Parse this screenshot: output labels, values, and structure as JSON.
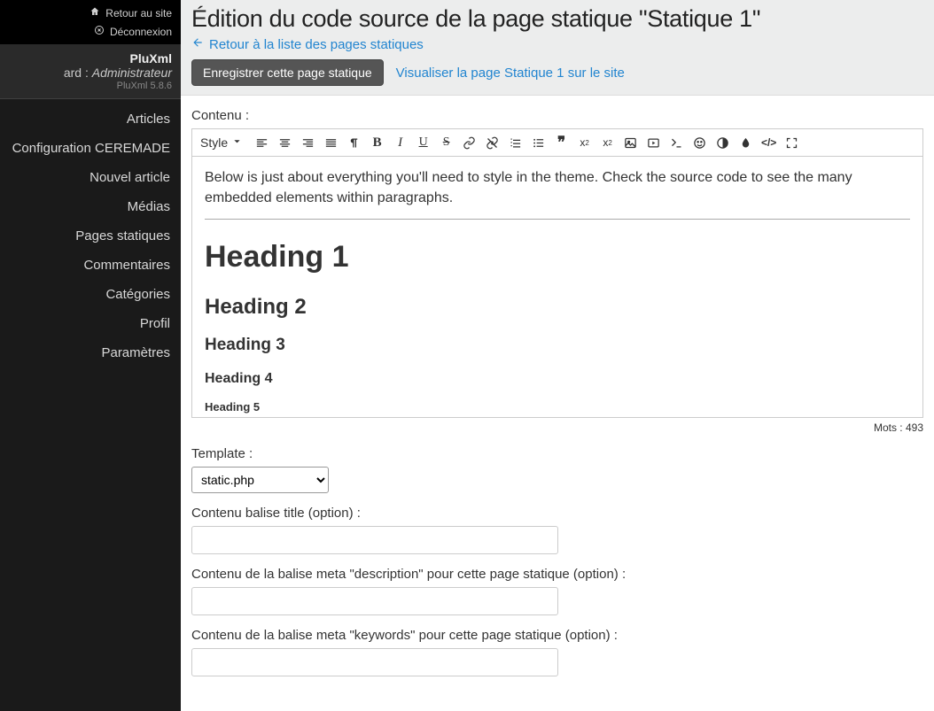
{
  "sidebar": {
    "top": {
      "home": "Retour au site",
      "logout": "Déconnexion"
    },
    "profile": {
      "app": "PluXml",
      "user": "ard",
      "sep": " : ",
      "role": "Administrateur",
      "version": "PluXml 5.8.6"
    },
    "nav": [
      "Articles",
      "Configuration CEREMADE",
      "Nouvel article",
      "Médias",
      "Pages statiques",
      "Commentaires",
      "Catégories",
      "Profil",
      "Paramètres"
    ]
  },
  "header": {
    "title": "Édition du code source de la page statique \"Statique 1\"",
    "back_label": "Retour à la liste des pages statiques",
    "save_button": "Enregistrer cette page statique",
    "view_link": "Visualiser la page Statique 1 sur le site"
  },
  "editor": {
    "content_label": "Contenu :",
    "style_label": "Style",
    "body": {
      "intro": "Below is just about everything you'll need to style in the theme. Check the source code to see the many embedded elements within paragraphs.",
      "h1": "Heading 1",
      "h2": "Heading 2",
      "h3": "Heading 3",
      "h4": "Heading 4",
      "h5": "Heading 5"
    },
    "word_count": "Mots : 493"
  },
  "form": {
    "template_label": "Template :",
    "template_value": "static.php",
    "title_tag_label": "Contenu balise title (option) :",
    "title_tag_value": "",
    "meta_desc_label": "Contenu de la balise meta \"description\" pour cette page statique (option) :",
    "meta_desc_value": "",
    "meta_kw_label": "Contenu de la balise meta \"keywords\" pour cette page statique (option) :",
    "meta_kw_value": ""
  }
}
